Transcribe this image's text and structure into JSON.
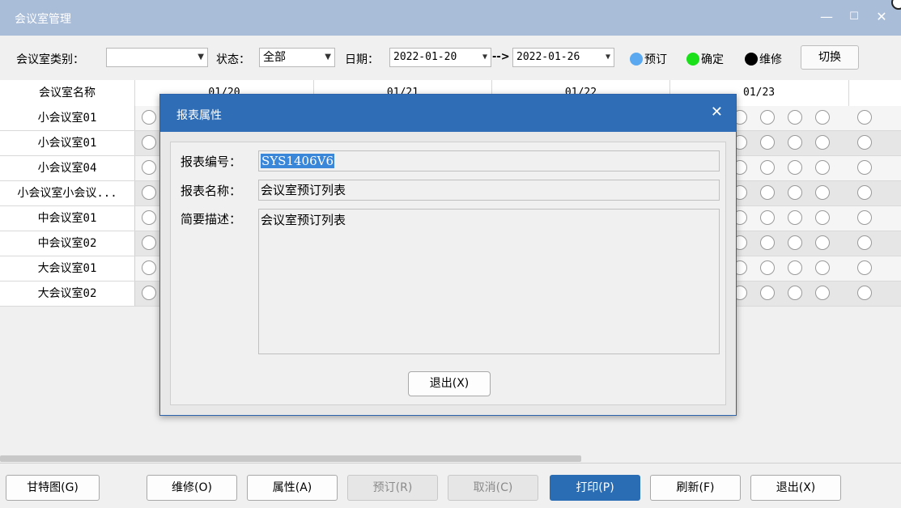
{
  "window": {
    "title": "会议室管理",
    "minimize": "—",
    "maximize": "☐",
    "close": "✕"
  },
  "toolbar": {
    "type_label": "会议室类别：",
    "type_value": "",
    "status_label": "状态：",
    "status_value": "全部",
    "date_label": "日期：",
    "date_from": "2022-01-20",
    "date_arrow": "-->",
    "date_to": "2022-01-26",
    "legend": [
      {
        "label": "预订",
        "color": "#5aa9f0"
      },
      {
        "label": "确定",
        "color": "#19e019"
      },
      {
        "label": "维修",
        "color": "#000000"
      }
    ],
    "switch_label": "切换"
  },
  "grid": {
    "name_header": "会议室名称",
    "dates": [
      "01/20",
      "01/21",
      "01/22",
      "01/23"
    ],
    "rooms": [
      "小会议室01",
      "小会议室01",
      "小会议室04",
      "小会议室小会议...",
      "中会议室01",
      "中会议室02",
      "大会议室01",
      "大会议室02"
    ]
  },
  "dialog": {
    "title": "报表属性",
    "close": "✕",
    "code_label": "报表编号：",
    "code_value": "SYS1406V6",
    "name_label": "报表名称：",
    "name_value": "会议室预订列表",
    "desc_label": "简要描述：",
    "desc_value": "会议室预订列表",
    "exit_label": "退出(X)"
  },
  "footer": {
    "gantt": "甘特图(G)",
    "repair": "维修(O)",
    "props": "属性(A)",
    "reserve": "预订(R)",
    "cancel": "取消(C)",
    "print": "打印(P)",
    "refresh": "刷新(F)",
    "exit": "退出(X)"
  }
}
